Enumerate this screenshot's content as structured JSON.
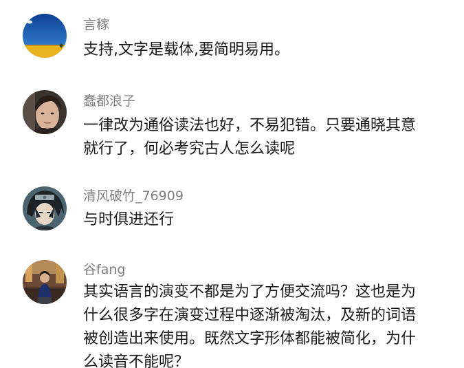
{
  "comments": [
    {
      "username": "言稼",
      "avatar_icon": "sky-field-avatar-icon",
      "lines": [
        "支持,文字是载体,要简明易用。"
      ]
    },
    {
      "username": "蠢都浪子",
      "avatar_icon": "portrait-avatar-icon",
      "lines": [
        "一律改为通俗读法也好，不易犯错。只要通晓其意",
        "就行了，何必考究古人怎么读呢"
      ]
    },
    {
      "username": "清风破竹_76909",
      "avatar_icon": "anime-character-avatar-icon",
      "lines": [
        "与时俱进还行"
      ]
    },
    {
      "username": "谷fang",
      "avatar_icon": "person-photo-avatar-icon",
      "lines": [
        "其实语言的演变不都是为了方便交流吗？这也是为",
        "什么很多字在演变过程中逐渐被淘汰，及新的词语",
        "被创造出来使用。既然文字形体都能被简化，为什",
        "么读音不能呢？"
      ]
    }
  ],
  "colors": {
    "username": "#7f7f7f",
    "content": "#1a1a1a",
    "background": "#ffffff"
  }
}
